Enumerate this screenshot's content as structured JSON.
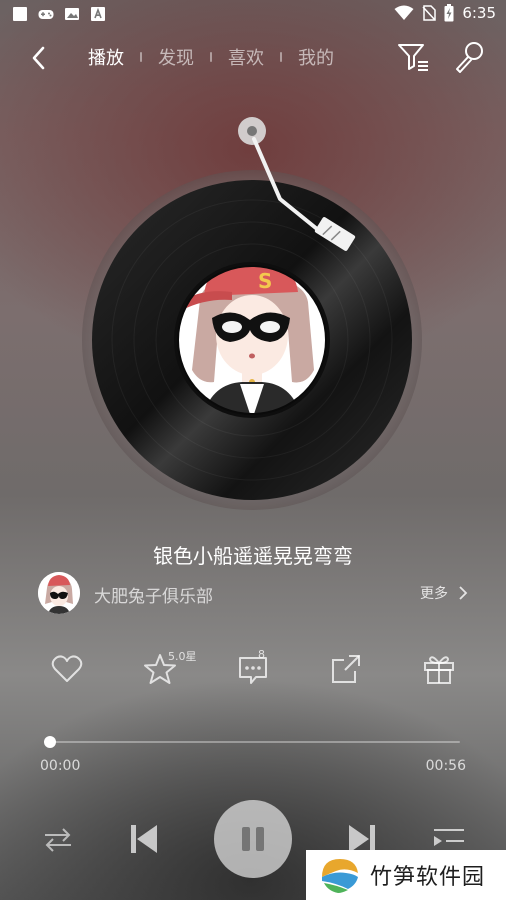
{
  "statusbar": {
    "time": "6:35",
    "left_icons": [
      "square-notification-icon",
      "gamepad-icon",
      "image-icon",
      "font-a-icon"
    ],
    "right_icons": [
      "wifi-icon",
      "no-sim-icon",
      "battery-charging-icon"
    ]
  },
  "nav": {
    "tabs": [
      {
        "label": "播放",
        "active": true
      },
      {
        "label": "发现",
        "active": false
      },
      {
        "label": "喜欢",
        "active": false
      },
      {
        "label": "我的",
        "active": false
      }
    ],
    "icons": [
      "back-icon",
      "filter-icon",
      "microphone-icon"
    ]
  },
  "song": {
    "title": "银色小船遥遥晃晃弯弯",
    "artist": "大肥兔子俱乐部",
    "more_label": "更多"
  },
  "actions": {
    "star_rating": "5.0星",
    "comment_count": "8",
    "icons": [
      "heart-icon",
      "star-icon",
      "comment-icon",
      "share-icon",
      "gift-icon"
    ]
  },
  "player": {
    "current_time": "00:00",
    "total_time": "00:56",
    "progress": 0.0
  },
  "controls": {
    "icons": [
      "repeat-icon",
      "previous-icon",
      "pause-icon",
      "next-icon",
      "playlist-icon"
    ]
  },
  "watermark": {
    "text": "竹笋软件园"
  },
  "colors": {
    "cap": "#d8585a",
    "vinyl": "#1b1b1b",
    "background_top": "#7a6464"
  }
}
